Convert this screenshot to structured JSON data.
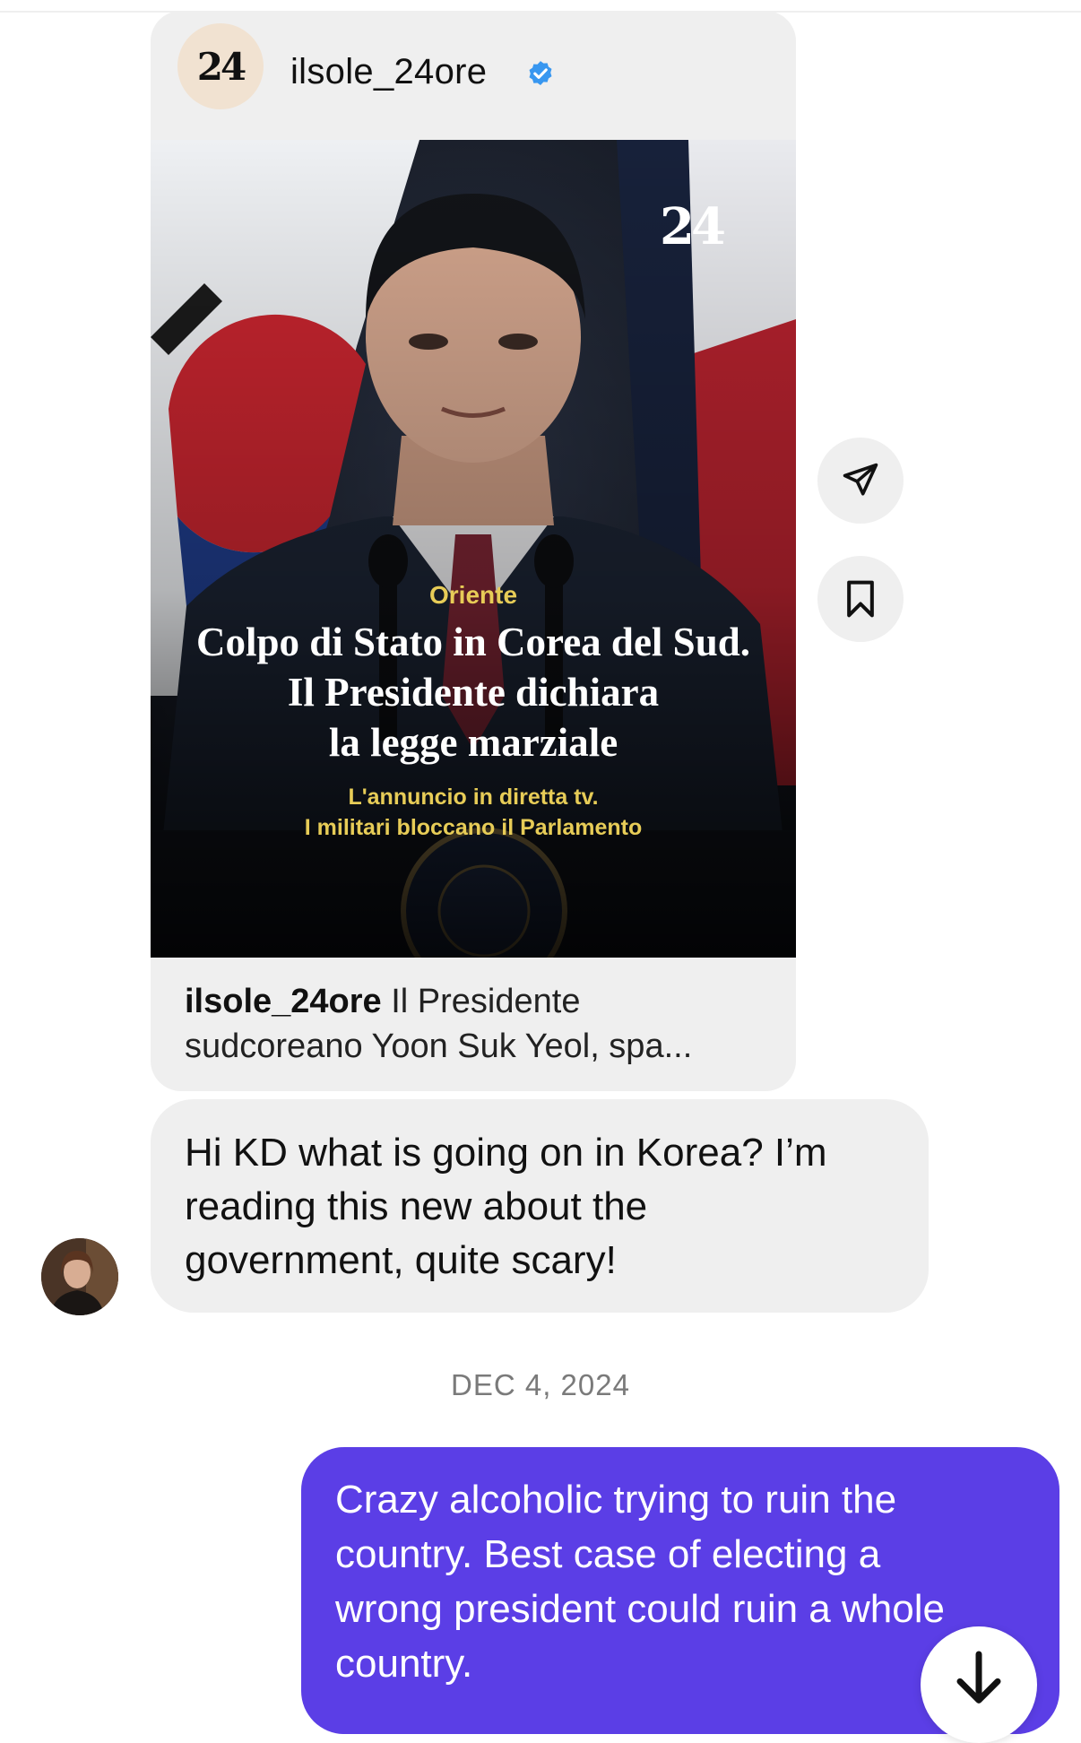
{
  "shared_post": {
    "account_name": "ilsole_24ore",
    "avatar_logo": "24",
    "verified": true,
    "image": {
      "logo": "24",
      "kicker": "Oriente",
      "headline_lines": [
        "Colpo di Stato in Corea del Sud.",
        "Il Presidente dichiara",
        "la legge marziale"
      ],
      "sub_lines": [
        "L'annuncio in diretta tv.",
        "I militari bloccano il Parlamento"
      ]
    },
    "caption_user": "ilsole_24ore",
    "caption_line1": " Il Presidente",
    "caption_line2": "sudcoreano Yoon Suk Yeol, spa..."
  },
  "actions": {
    "share_icon": "send-icon",
    "save_icon": "bookmark-icon"
  },
  "incoming_message": {
    "text_lines": [
      "Hi KD what is going on in Korea? I’m",
      "reading this new about the",
      "government, quite scary!"
    ]
  },
  "timestamp": "DEC 4, 2024",
  "outgoing_message": {
    "text_lines": [
      "Crazy alcoholic trying to ruin the",
      "country. Best case of electing a",
      "wrong president could ruin a whole",
      "country."
    ]
  },
  "colors": {
    "bubble_gray": "#efefef",
    "outgoing_purple": "#5b3ee6",
    "verified_blue": "#3897f0",
    "kicker_yellow": "#e7cc57"
  }
}
